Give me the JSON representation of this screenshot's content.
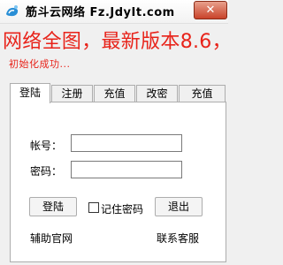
{
  "window": {
    "title": "筋斗云网络 Fz.JdyIt.com",
    "close_label": "✕"
  },
  "banner": {
    "marquee_text": "网络全图，最新版本8.6，",
    "status_text": "初始化成功..."
  },
  "tabs": [
    {
      "label": "登陆",
      "active": true
    },
    {
      "label": "注册",
      "active": false
    },
    {
      "label": "充值",
      "active": false
    },
    {
      "label": "改密",
      "active": false
    },
    {
      "label": "充值",
      "active": false
    }
  ],
  "login": {
    "account_label": "帐号：",
    "account_value": "",
    "password_label": "密码：",
    "password_value": "",
    "login_button": "登陆",
    "remember_label": "记住密码",
    "remember_checked": false,
    "exit_button": "退出"
  },
  "footer": {
    "assist_link": "辅助官网",
    "contact_link": "联系客服"
  },
  "colors": {
    "accent_red": "#e8231a",
    "close_button": "#c9432a"
  }
}
